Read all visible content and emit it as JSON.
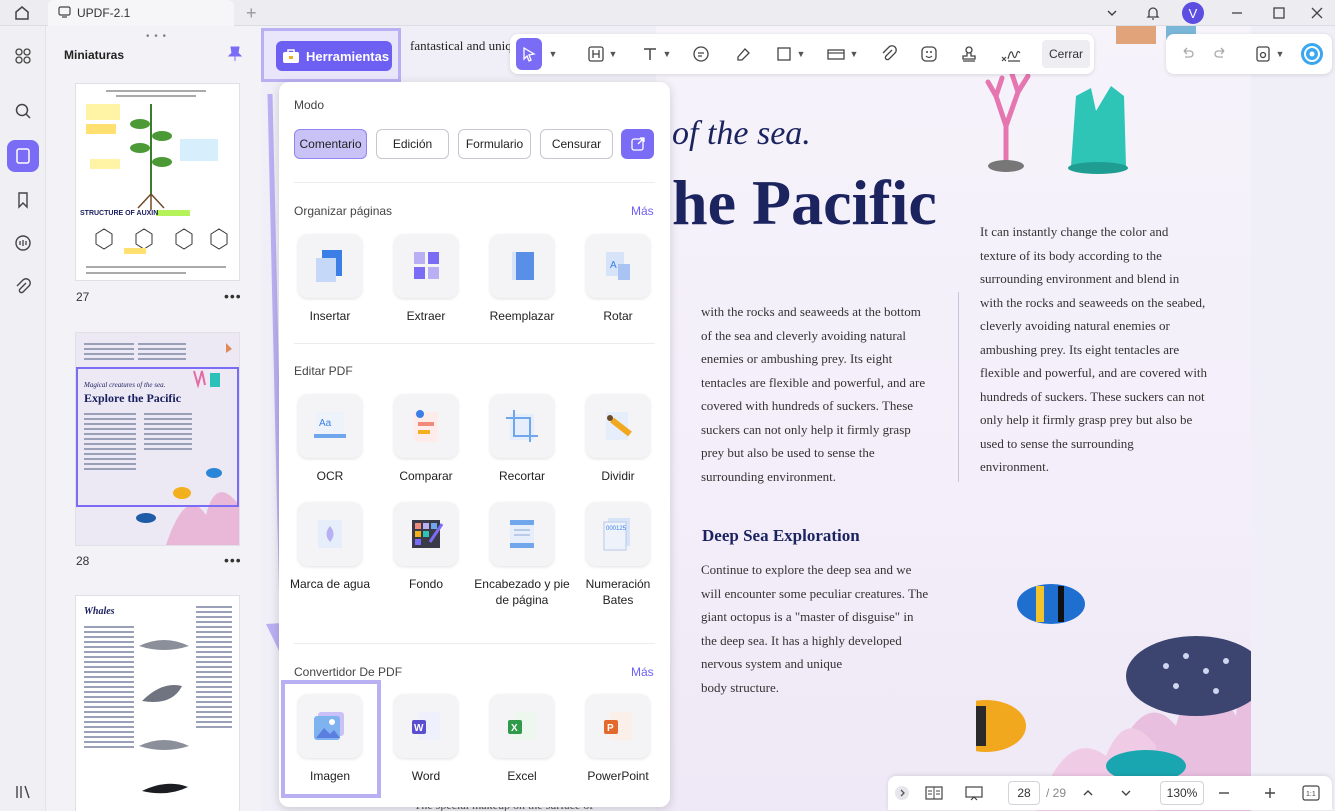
{
  "window": {
    "tab_title": "UPDF-2.1",
    "avatar_initial": "V"
  },
  "thumbnails": {
    "title": "Miniaturas",
    "pages": [
      {
        "num": "27"
      },
      {
        "num": "28",
        "mini_heading_italic": "Magical creatures of the sea.",
        "mini_heading": "Explore the Pacific"
      },
      {
        "num": "",
        "mini_heading": "Whales"
      }
    ],
    "page27_title": "STRUCTURE OF AUXIN"
  },
  "document": {
    "top_fragment": "fantastical and uniq",
    "heading_italic": "of the sea.",
    "heading_big": "he Pacific",
    "column_left": [
      "with the rocks and seaweeds at the bottom",
      "of the sea and cleverly avoiding natural",
      "enemies or ambushing prey. Its eight",
      "tentacles are flexible and powerful, and are",
      "covered with hundreds of suckers. These",
      "suckers can not only help it firmly grasp",
      "prey but also be used to sense the",
      "surrounding environment."
    ],
    "column_right": [
      "It can instantly change the color and",
      "texture of its body according to the",
      "surrounding environment and blend in",
      "with the rocks and seaweeds on the seabed,",
      "cleverly avoiding natural enemies or",
      "ambushing prey. Its eight tentacles are",
      "flexible and powerful, and are covered with",
      "hundreds of suckers. These suckers can not",
      "only help it firmly grasp prey but also be",
      "used to sense the surrounding",
      "environment."
    ],
    "section_title": "Deep Sea Exploration",
    "section_text": [
      "Continue to explore the deep sea and we",
      "will encounter some peculiar creatures. The",
      "giant octopus is a \"master of disguise\" in",
      "the deep sea. It has a highly developed",
      "nervous system and unique",
      "body structure."
    ],
    "bottom_fragment": "The special makeup on the surface of"
  },
  "toolbar": {
    "close_label": "Cerrar"
  },
  "tools_button": {
    "label": "Herramientas"
  },
  "popover": {
    "mode_label": "Modo",
    "modes": [
      "Comentario",
      "Edición",
      "Formulario",
      "Censurar"
    ],
    "organize": {
      "label": "Organizar páginas",
      "more": "Más",
      "items": [
        "Insertar",
        "Extraer",
        "Reemplazar",
        "Rotar"
      ]
    },
    "edit": {
      "label": "Editar PDF",
      "items": [
        "OCR",
        "Comparar",
        "Recortar",
        "Dividir",
        "Marca de agua",
        "Fondo",
        "Encabezado y pie de página",
        "Numeración Bates"
      ]
    },
    "convert": {
      "label": "Convertidor De PDF",
      "more": "Más",
      "items": [
        "Imagen",
        "Word",
        "Excel",
        "PowerPoint"
      ]
    }
  },
  "bottombar": {
    "current_page": "28",
    "total_pages": "/ 29",
    "zoom": "130%"
  }
}
